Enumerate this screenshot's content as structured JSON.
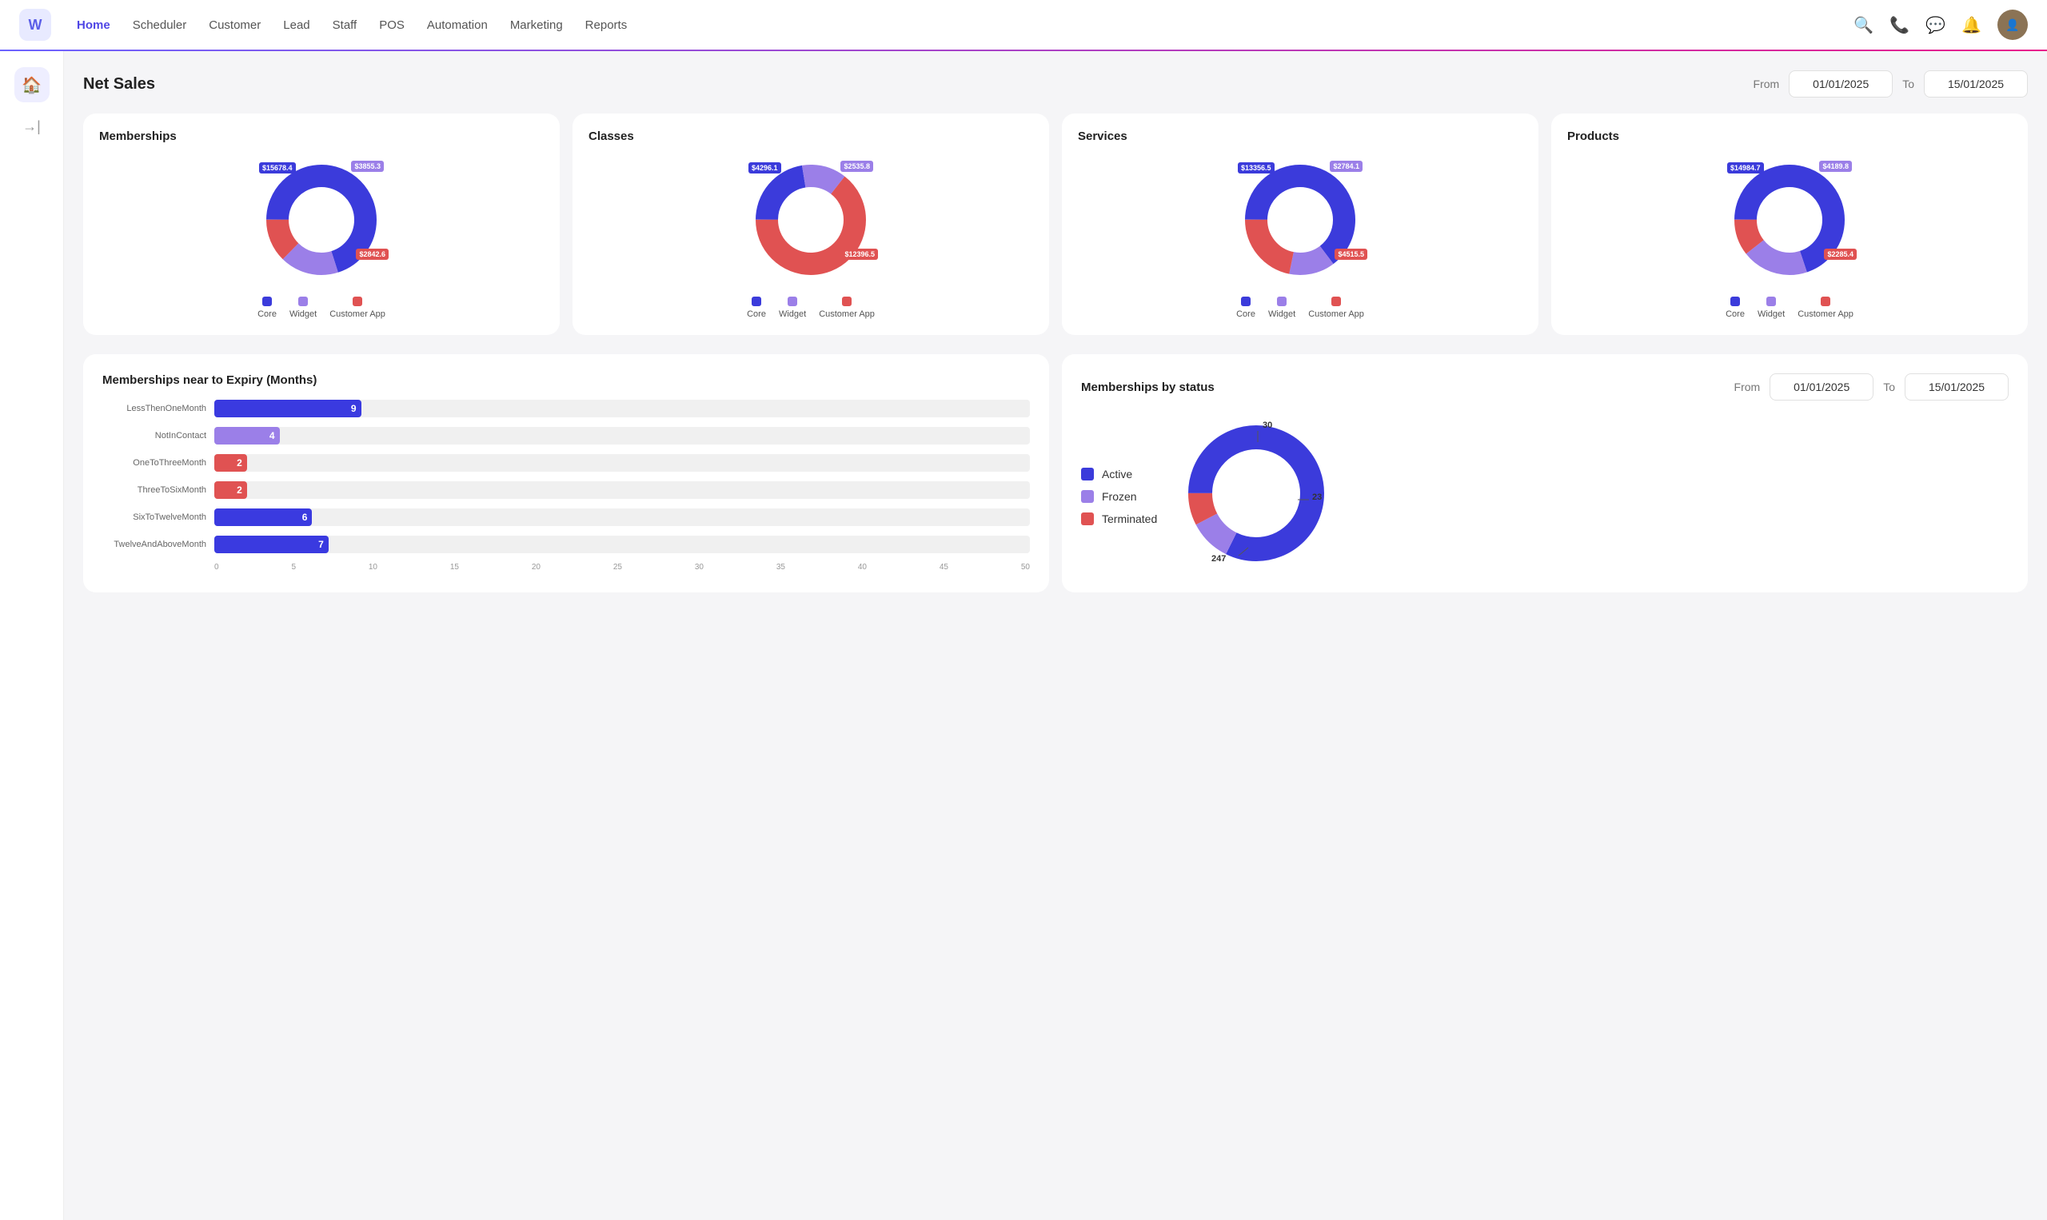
{
  "nav": {
    "logo": "W",
    "links": [
      {
        "label": "Home",
        "active": true
      },
      {
        "label": "Scheduler",
        "active": false
      },
      {
        "label": "Customer",
        "active": false
      },
      {
        "label": "Lead",
        "active": false
      },
      {
        "label": "Staff",
        "active": false
      },
      {
        "label": "POS",
        "active": false
      },
      {
        "label": "Automation",
        "active": false
      },
      {
        "label": "Marketing",
        "active": false
      },
      {
        "label": "Reports",
        "active": false
      }
    ]
  },
  "net_sales": {
    "title": "Net Sales",
    "from_label": "From",
    "to_label": "To",
    "from_date": "01/01/2025",
    "to_date": "15/01/2025"
  },
  "charts": [
    {
      "title": "Memberships",
      "core": "15678.4",
      "widget": "3855.3",
      "customer_app": "2842.6",
      "colors": {
        "core": "#3b3bdb",
        "widget": "#9b7fe8",
        "customer_app": "#e05252"
      }
    },
    {
      "title": "Classes",
      "core": "4296.1",
      "widget": "2535.8",
      "customer_app": "12396.5",
      "colors": {
        "core": "#3b3bdb",
        "widget": "#9b7fe8",
        "customer_app": "#e05252"
      }
    },
    {
      "title": "Services",
      "core": "13356.5",
      "widget": "2784.1",
      "customer_app": "4515.5",
      "colors": {
        "core": "#3b3bdb",
        "widget": "#9b7fe8",
        "customer_app": "#e05252"
      }
    },
    {
      "title": "Products",
      "core": "14984.7",
      "widget": "4189.8",
      "customer_app": "2285.4",
      "colors": {
        "core": "#3b3bdb",
        "widget": "#9b7fe8",
        "customer_app": "#e05252"
      }
    }
  ],
  "expiry": {
    "title": "Memberships near to Expiry (Months)",
    "bars": [
      {
        "label": "LessThenOneMonth",
        "value": 9,
        "max": 50,
        "color": "blue"
      },
      {
        "label": "NotInContact",
        "value": 4,
        "max": 50,
        "color": "purple"
      },
      {
        "label": "OneToThreeMonth",
        "value": 2,
        "max": 50,
        "color": "red"
      },
      {
        "label": "ThreeToSixMonth",
        "value": 2,
        "max": 50,
        "color": "red"
      },
      {
        "label": "SixToTwelveMonth",
        "value": 6,
        "max": 50,
        "color": "blue"
      },
      {
        "label": "TwelveAndAboveMonth",
        "value": 7,
        "max": 50,
        "color": "blue"
      }
    ],
    "axis": [
      "0",
      "5",
      "10",
      "15",
      "20",
      "25",
      "30",
      "35",
      "40",
      "45",
      "50"
    ]
  },
  "membership_status": {
    "title": "Memberships by status",
    "from_label": "From",
    "to_label": "To",
    "from_date": "01/01/2025",
    "to_date": "15/01/2025",
    "legend": [
      {
        "label": "Active",
        "color": "#3b3bdb"
      },
      {
        "label": "Frozen",
        "color": "#9b7fe8"
      },
      {
        "label": "Terminated",
        "color": "#e05252"
      }
    ],
    "values": {
      "active": 247,
      "frozen": 30,
      "terminated": 23
    }
  }
}
